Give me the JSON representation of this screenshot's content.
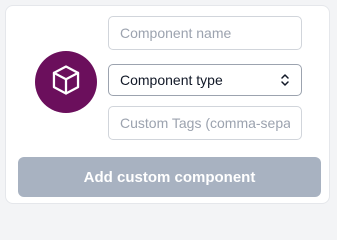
{
  "form": {
    "avatar_icon": "cube-icon",
    "avatar_color": "#6b0f5c",
    "name_placeholder": "Component name",
    "name_value": "",
    "type_label": "Component type",
    "type_icon": "chevron-up-down-icon",
    "tags_placeholder": "Custom Tags (comma-separated)",
    "tags_value": "",
    "submit_label": "Add custom component",
    "submit_color": "#a8b2c1",
    "submit_disabled": true
  }
}
